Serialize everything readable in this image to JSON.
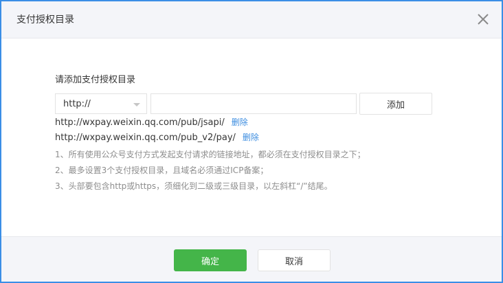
{
  "dialog": {
    "title": "支付授权目录"
  },
  "form": {
    "label": "请添加支付授权目录",
    "protocol_selected": "http://",
    "url_value": "",
    "url_placeholder": "",
    "add_label": "添加"
  },
  "directories": [
    {
      "url": "http://wxpay.weixin.qq.com/pub/jsapi/",
      "delete_label": "删除"
    },
    {
      "url": "http://wxpay.weixin.qq.com/pub_v2/pay/",
      "delete_label": "删除"
    }
  ],
  "notes": [
    "1、所有使用公众号支付方式发起支付请求的链接地址，都必须在支付授权目录之下；",
    "2、最多设置3个支付授权目录，且域名必须通过ICP备案；",
    "3、头部要包含http或https，须细化到二级或三级目录，以左斜杠“/”结尾。"
  ],
  "footer": {
    "confirm_label": "确定",
    "cancel_label": "取消"
  },
  "colors": {
    "border": "#3a8ee6",
    "confirm": "#44b549",
    "link": "#3e8ee0"
  },
  "icons": {
    "close": "close-icon",
    "select_caret": "caret-down-icon"
  }
}
